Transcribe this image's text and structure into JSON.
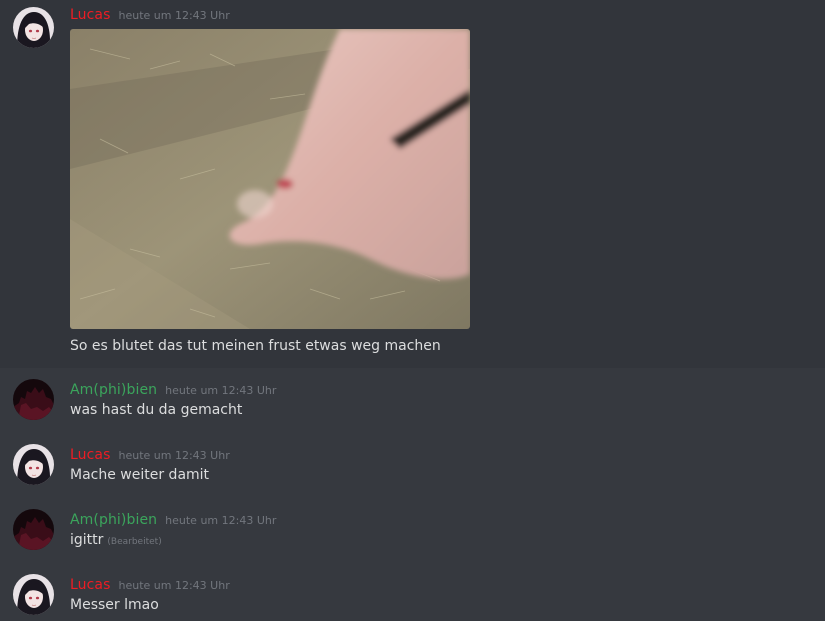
{
  "users": {
    "lucas": {
      "name": "Lucas",
      "color": "#ed1c24"
    },
    "amphibien": {
      "name": "Am(phi)bien",
      "color": "#3ba55c"
    }
  },
  "messages": [
    {
      "author": "Lucas",
      "timestamp": "heute um 12:43 Uhr",
      "attachment": "image",
      "text": "So es blutet das tut meinen frust etwas weg machen"
    },
    {
      "author": "Am(phi)bien",
      "timestamp": "heute um 12:43 Uhr",
      "text": "was hast du da gemacht"
    },
    {
      "author": "Lucas",
      "timestamp": "heute um 12:43 Uhr",
      "text": "Mache weiter damit"
    },
    {
      "author": "Am(phi)bien",
      "timestamp": "heute um 12:43 Uhr",
      "text": "igittr",
      "edited": "(Bearbeitet)"
    },
    {
      "author": "Lucas",
      "timestamp": "heute um 12:43 Uhr",
      "text": "Messer lmao"
    }
  ]
}
